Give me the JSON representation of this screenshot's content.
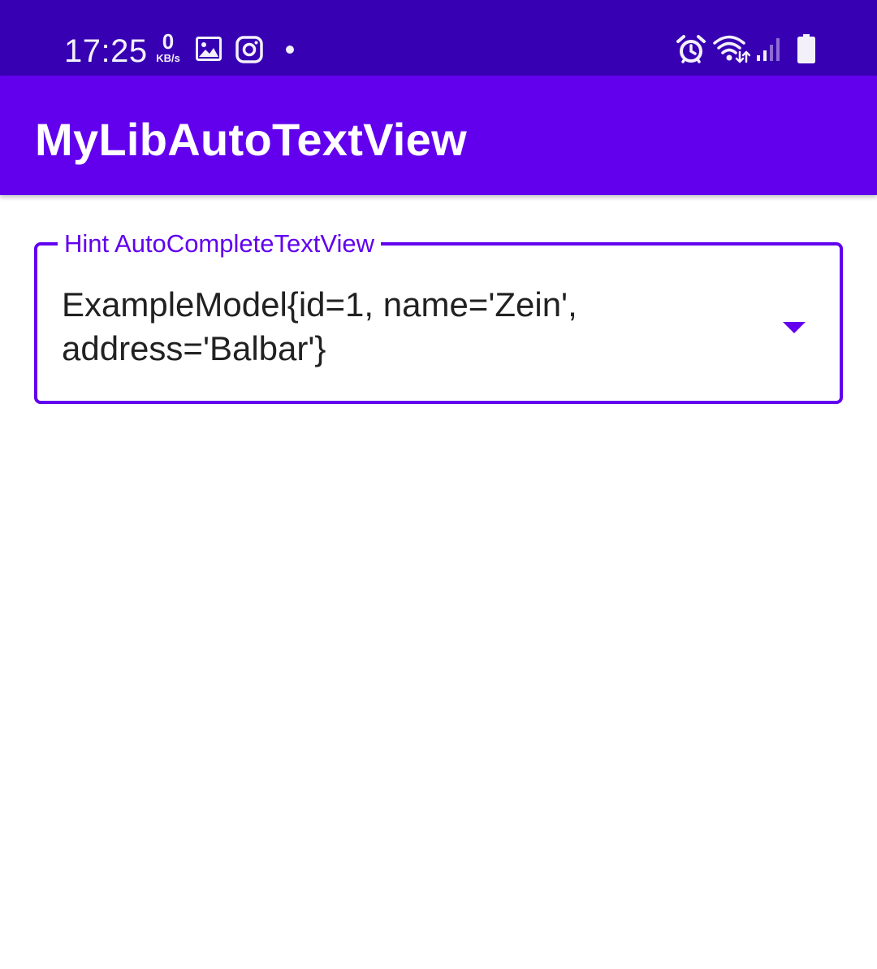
{
  "status_bar": {
    "time": "17:25",
    "net_speed_value": "0",
    "net_speed_unit": "KB/s",
    "icons": [
      "gallery-icon",
      "instagram-icon",
      "dot-icon",
      "alarm-icon",
      "wifi-icon",
      "signal-icon",
      "battery-icon"
    ],
    "background": "#3700b3"
  },
  "app_bar": {
    "title": "MyLibAutoTextView",
    "background": "#6200ee"
  },
  "autocomplete": {
    "hint": "Hint AutoCompleteTextView",
    "value": "ExampleModel{id=1, name='Zein',\naddress='Balbar'}",
    "dropdown_icon": "arrow-drop-down-icon",
    "accent": "#6200ee"
  }
}
